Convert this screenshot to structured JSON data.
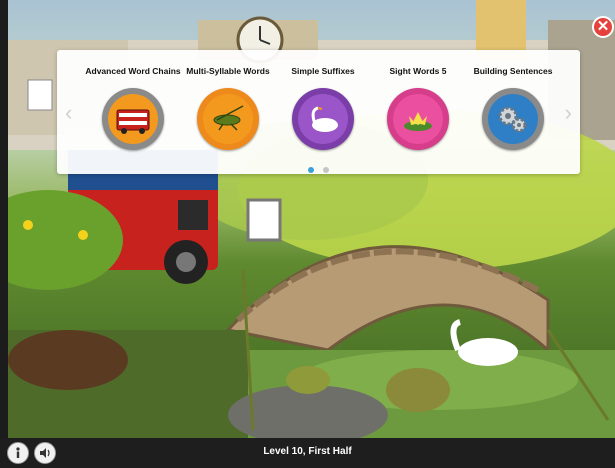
{
  "categories": [
    {
      "label": "Advanced Word Chains",
      "icon": "double-decker-bus-icon",
      "ring": "#8a8a8a",
      "fill": "#f39a1e"
    },
    {
      "label": "Multi-Syllable Words",
      "icon": "grasshopper-icon",
      "ring": "#ee8a1c",
      "fill": "#f39a1e"
    },
    {
      "label": "Simple Suffixes",
      "icon": "swan-icon",
      "ring": "#7b3ea8",
      "fill": "#9a55c8"
    },
    {
      "label": "Sight Words 5",
      "icon": "water-lily-icon",
      "ring": "#d63d8a",
      "fill": "#ea4fa0"
    },
    {
      "label": "Building Sentences",
      "icon": "gears-icon",
      "ring": "#8a8a8a",
      "fill": "#2f7fc6"
    }
  ],
  "pagination": {
    "pages": 2,
    "current": 1
  },
  "footer": {
    "level_text": "Level 10, First Half"
  },
  "buttons": {
    "info": "info-icon",
    "sound": "speaker-icon",
    "close": "close-icon"
  }
}
